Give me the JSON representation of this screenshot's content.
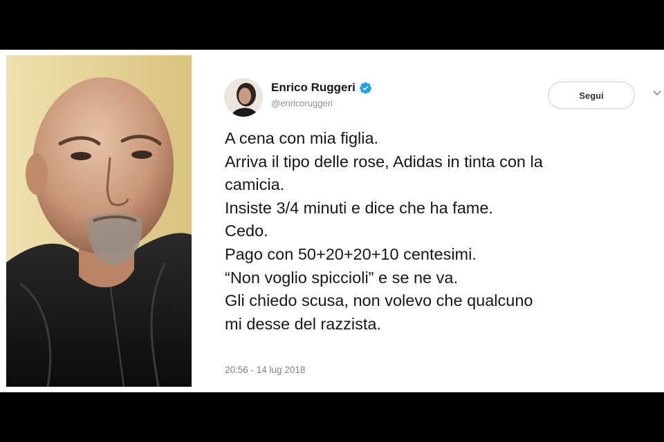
{
  "tweet": {
    "author_name": "Enrico Ruggeri",
    "handle": "@enricoruggeri",
    "follow_label": "Segui",
    "verified_icon": "verified-badge-icon",
    "more_icon": "chevron-down-icon",
    "lines": [
      "A cena con mia figlia.",
      "Arriva il tipo delle rose, Adidas in tinta con la",
      "camicia.",
      "Insiste 3/4 minuti e dice che ha fame.",
      "Cedo.",
      "Pago con 50+20+20+10 centesimi.",
      "“Non voglio spiccioli” e se ne va.",
      "Gli chiedo scusa, non volevo che qualcuno",
      "mi desse del razzista."
    ],
    "timestamp": "20:56 - 14 lug 2018"
  },
  "colors": {
    "verified": "#1da1f2",
    "text": "#14171a",
    "muted": "#8a9198",
    "photo_background": "#e8d9a2"
  }
}
